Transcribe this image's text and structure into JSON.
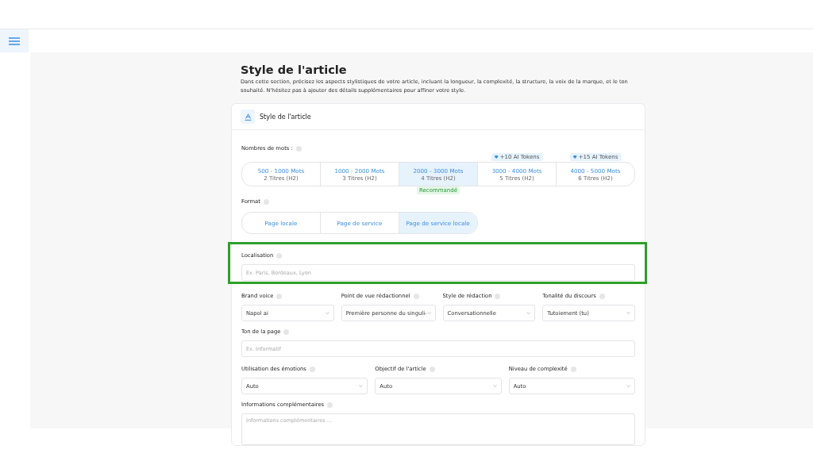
{
  "section": {
    "title": "Style de l'article",
    "description": "Dans cette section, précisez les aspects stylistiques de votre article, incluant la longueur, la complexité, la structure, la voix de la marque, et le ton souhaité. N'hésitez pas à ajouter des détails supplémentaires pour affiner votre style."
  },
  "card": {
    "title": "Style de l'article",
    "word_count": {
      "label": "Nombres de mots :",
      "options": [
        {
          "label": "500 - 1000 Mots",
          "sub": "2 Titres (H2)",
          "selected": false
        },
        {
          "label": "1000 - 2000 Mots",
          "sub": "3 Titres (H2)",
          "selected": false
        },
        {
          "label": "2000 - 3000 Mots",
          "sub": "4 Titres (H2)",
          "selected": true,
          "badge": "Recommandé"
        },
        {
          "label": "3000 - 4000 Mots",
          "sub": "5 Titres (H2)",
          "selected": false,
          "tokens": "+10 AI Tokens"
        },
        {
          "label": "4000 - 5000 Mots",
          "sub": "6 Titres (H2)",
          "selected": false,
          "tokens": "+15 AI Tokens"
        }
      ]
    },
    "format": {
      "label": "Format",
      "options": [
        {
          "label": "Page locale",
          "selected": false
        },
        {
          "label": "Page de service",
          "selected": false
        },
        {
          "label": "Page de service locale",
          "selected": true
        }
      ]
    },
    "localisation": {
      "label": "Localisation",
      "placeholder": "Ex. Paris, Bordeaux, Lyon",
      "highlighted": true
    },
    "selects_row_1": [
      {
        "label": "Brand voice",
        "value": "Napol ai"
      },
      {
        "label": "Point de vue rédactionnel",
        "value": "Première personne du singuli-"
      },
      {
        "label": "Style de rédaction",
        "value": "Conversationnelle"
      },
      {
        "label": "Tonalité du discours",
        "value": "Tutoiement (tu)"
      }
    ],
    "tone": {
      "label": "Ton de la page",
      "placeholder": "Ex. Informatif"
    },
    "selects_row_2": [
      {
        "label": "Utilisation des émotions",
        "value": "Auto"
      },
      {
        "label": "Objectif de l'article",
        "value": "Auto"
      },
      {
        "label": "Niveau de complexité",
        "value": "Auto"
      }
    ],
    "extra": {
      "label": "Informations complémentaires",
      "placeholder": "Informations complémentaires ..."
    }
  }
}
